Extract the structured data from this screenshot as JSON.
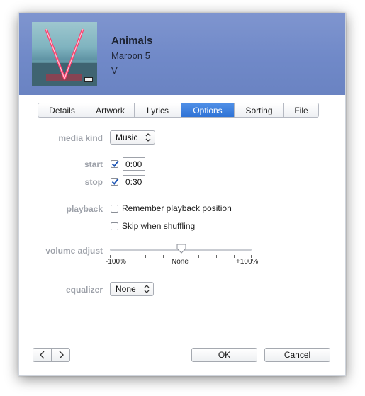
{
  "header": {
    "title": "Animals",
    "artist": "Maroon 5",
    "album": "V",
    "background_color": "#7089c8"
  },
  "tabs": [
    {
      "label": "Details",
      "active": false
    },
    {
      "label": "Artwork",
      "active": false
    },
    {
      "label": "Lyrics",
      "active": false
    },
    {
      "label": "Options",
      "active": true
    },
    {
      "label": "Sorting",
      "active": false
    },
    {
      "label": "File",
      "active": false
    }
  ],
  "options": {
    "media_kind": {
      "label": "media kind",
      "value": "Music"
    },
    "start": {
      "label": "start",
      "checked": true,
      "value": "0:00"
    },
    "stop": {
      "label": "stop",
      "checked": true,
      "value": "0:30"
    },
    "playback": {
      "label": "playback",
      "remember_label": "Remember playback position",
      "remember_checked": false,
      "skip_label": "Skip when shuffling",
      "skip_checked": false
    },
    "volume_adjust": {
      "label": "volume adjust",
      "min_label": "-100%",
      "mid_label": "None",
      "max_label": "+100%",
      "value_percent": 0
    },
    "equalizer": {
      "label": "equalizer",
      "value": "None"
    }
  },
  "footer": {
    "prev_icon": "chevron-left-icon",
    "next_icon": "chevron-right-icon",
    "ok_label": "OK",
    "cancel_label": "Cancel"
  },
  "colors": {
    "accent": "#2f73d6",
    "label_gray": "#9ea2aa"
  }
}
